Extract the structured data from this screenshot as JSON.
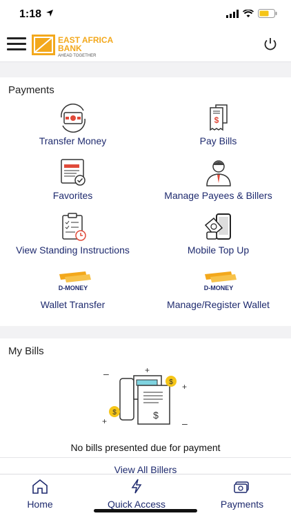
{
  "status_bar": {
    "time": "1:18"
  },
  "header": {
    "logo_text_line1": "EAST AFRICA",
    "logo_text_line2": "BANK",
    "logo_tagline": "AHEAD TOGETHER"
  },
  "payments": {
    "title": "Payments",
    "tiles": [
      {
        "label": "Transfer Money",
        "icon": "transfer-money-icon"
      },
      {
        "label": "Pay Bills",
        "icon": "pay-bills-icon"
      },
      {
        "label": "Favorites",
        "icon": "favorites-icon"
      },
      {
        "label": "Manage Payees & Billers",
        "icon": "manage-payees-icon"
      },
      {
        "label": "View Standing Instructions",
        "icon": "standing-instructions-icon"
      },
      {
        "label": "Mobile Top Up",
        "icon": "mobile-top-up-icon"
      },
      {
        "label": "Wallet Transfer",
        "icon": "d-money-wallet-icon",
        "badge": "D-MONEY"
      },
      {
        "label": "Manage/Register Wallet",
        "icon": "d-money-wallet-icon",
        "badge": "D-MONEY"
      }
    ]
  },
  "my_bills": {
    "title": "My Bills",
    "empty_message": "No bills presented due for payment",
    "view_all_label": "View All Billers"
  },
  "bottom_nav": {
    "items": [
      {
        "label": "Home",
        "icon": "home-icon"
      },
      {
        "label": "Quick Access",
        "icon": "lightning-icon"
      },
      {
        "label": "Payments",
        "icon": "payments-icon"
      }
    ]
  },
  "colors": {
    "brand": "#f3a81c",
    "link": "#1e2a6e"
  }
}
